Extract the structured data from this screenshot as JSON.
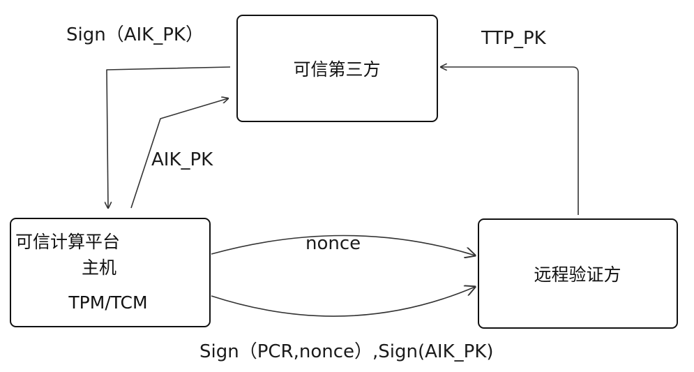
{
  "nodes": {
    "ttp": {
      "label": "可信第三方"
    },
    "host": {
      "line1": "可信计算平台",
      "line2": "主机",
      "line3": "TPM/TCM"
    },
    "verifier": {
      "label": "远程验证方"
    }
  },
  "edges": {
    "sign_aik_pk": "Sign（AIK_PK）",
    "aik_pk": "AIK_PK",
    "ttp_pk": "TTP_PK",
    "nonce": "nonce",
    "sign_pcr": "Sign（PCR,nonce）,Sign(AIK_PK)"
  }
}
